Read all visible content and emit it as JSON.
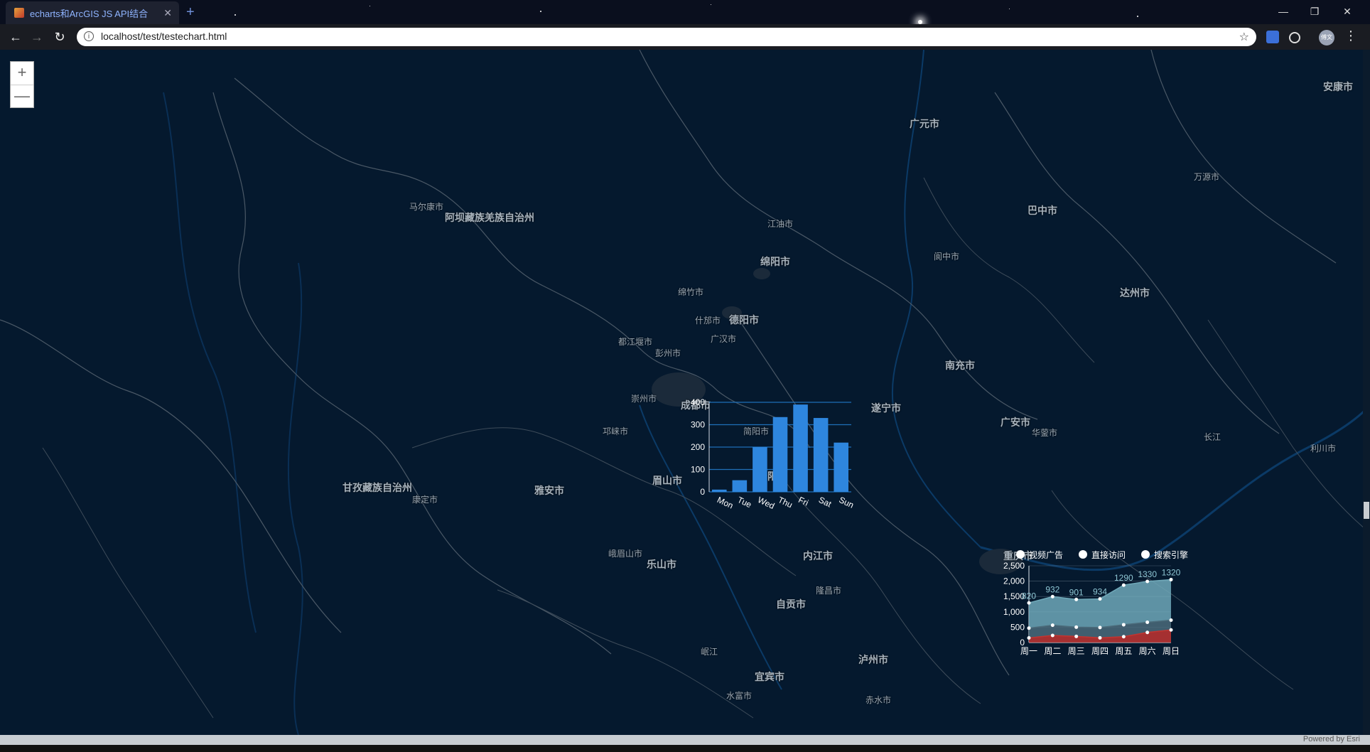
{
  "browser": {
    "tab_title": "echarts和ArcGIS JS API结合",
    "tab_close": "✕",
    "new_tab": "+",
    "url": "localhost/test/testechart.html",
    "window_controls": {
      "minimize": "—",
      "restore": "❐",
      "close": "✕"
    },
    "nav": {
      "back": "←",
      "forward": "→",
      "reload": "↻"
    },
    "info_icon": "i",
    "bookmark_icon": "☆",
    "menu_icon": "⋮",
    "profile_initial": "傅文"
  },
  "map": {
    "zoom_in": "+",
    "zoom_out": "—",
    "attribution": "Powered by Esri",
    "labels": {
      "ankang": "安康市",
      "guangyuan": "广元市",
      "wanyuan": "万源市",
      "maerkang": "马尔康市",
      "aba": "阿坝藏族羌族自治州",
      "jiangyou": "江油市",
      "bazhong": "巴中市",
      "mianyang": "绵阳市",
      "langzhong": "阆中市",
      "mianzhu": "绵竹市",
      "dazhou": "达州市",
      "shifang": "什邡市",
      "deyang": "德阳市",
      "dujiangyan": "都江堰市",
      "guanghan": "广汉市",
      "pengzhou": "彭州市",
      "nanchong": "南充市",
      "chongzhou": "崇州市",
      "chengdu": "成都市",
      "suining": "遂宁市",
      "guangan": "广安市",
      "huaying": "华蓥市",
      "jianyang": "简阳市",
      "qionglai": "邛崃市",
      "changjiang": "长江",
      "lichuan": "利川市",
      "ganzi": "甘孜藏族自治州",
      "yaan": "雅安市",
      "meishan": "眉山市",
      "ziyang": "资阳市",
      "kangding": "康定市",
      "emeishan": "峨眉山市",
      "leshan": "乐山市",
      "neijiang": "内江市",
      "chongqing": "重庆市",
      "longchang": "隆昌市",
      "zigong": "自贡市",
      "minjiang": "岷江",
      "luzhou": "泸州市",
      "yibin": "宜宾市",
      "shuifu": "水富市",
      "chishui": "赤水市"
    }
  },
  "bar_chart": {
    "chart_data": {
      "type": "bar",
      "categories": [
        "Mon",
        "Tue",
        "Wed",
        "Thu",
        "Fri",
        "Sat",
        "Sun"
      ],
      "values": [
        10,
        52,
        200,
        334,
        390,
        330,
        220
      ],
      "ylim": [
        0,
        400
      ],
      "yticks": [
        "0",
        "100",
        "200",
        "300",
        "400"
      ],
      "grid": true,
      "color": "#2e86de"
    }
  },
  "line_chart": {
    "chart_data": {
      "type": "area",
      "categories": [
        "周一",
        "周二",
        "周三",
        "周四",
        "周五",
        "周六",
        "周日"
      ],
      "series": [
        {
          "name": "视频广告",
          "values": [
            150,
            232,
            201,
            154,
            190,
            330,
            410
          ],
          "color": "#c23531"
        },
        {
          "name": "直接访问",
          "values": [
            320,
            332,
            301,
            334,
            390,
            330,
            320
          ],
          "color": "#4b6b7a"
        },
        {
          "name": "搜索引擎",
          "values": [
            820,
            932,
            901,
            934,
            1290,
            1330,
            1320
          ],
          "color": "#6fa8b8"
        }
      ],
      "stacked": true,
      "ylim": [
        0,
        2500
      ],
      "yticks": [
        "0",
        "500",
        "1,000",
        "1,500",
        "2,000",
        "2,500"
      ],
      "data_labels": [
        "820",
        "932",
        "901",
        "934",
        "1290",
        "1330",
        "1320"
      ],
      "legend_position": "top"
    }
  }
}
